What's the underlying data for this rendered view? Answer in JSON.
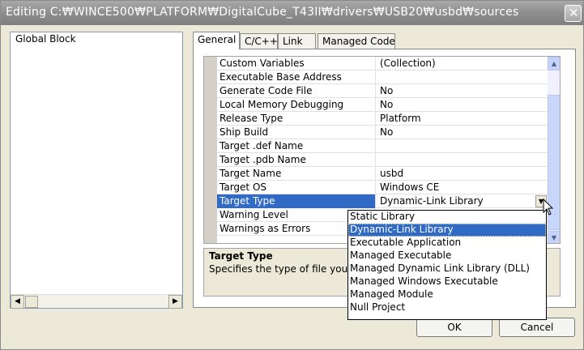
{
  "window": {
    "title": "Editing C:₩WINCE500₩PLATFORM₩DigitalCube_T43II₩drivers₩USB20₩usbd₩sources"
  },
  "left_tree": {
    "items": [
      "Global Block"
    ]
  },
  "tabs": [
    "General",
    "C/C++",
    "Link",
    "Managed Code"
  ],
  "properties": [
    {
      "name": "Custom Variables",
      "value": "(Collection)"
    },
    {
      "name": "Executable Base Address",
      "value": ""
    },
    {
      "name": "Generate Code File",
      "value": "No"
    },
    {
      "name": "Local Memory Debugging",
      "value": "No"
    },
    {
      "name": "Release Type",
      "value": "Platform"
    },
    {
      "name": "Ship Build",
      "value": "No"
    },
    {
      "name": "Target .def Name",
      "value": ""
    },
    {
      "name": "Target .pdb Name",
      "value": ""
    },
    {
      "name": "Target Name",
      "value": "usbd"
    },
    {
      "name": "Target OS",
      "value": "Windows CE"
    },
    {
      "name": "Target Type",
      "value": "Dynamic-Link Library"
    },
    {
      "name": "Warning Level",
      "value": ""
    },
    {
      "name": "Warnings as Errors",
      "value": ""
    }
  ],
  "selected_property": "Target Type",
  "description": {
    "title": "Target Type",
    "text": "Specifies the type of file you w"
  },
  "dropdown": {
    "options": [
      "Static Library",
      "Dynamic-Link Library",
      "Executable Application",
      "Managed Executable",
      "Managed Dynamic Link Library (DLL)",
      "Managed Windows Executable",
      "Managed Module",
      "Null Project"
    ],
    "selected": "Dynamic-Link Library"
  },
  "buttons": {
    "ok": "OK",
    "cancel": "Cancel"
  },
  "icons": {
    "close": "close-icon",
    "scroll_left": "arrow-left-icon",
    "scroll_right": "arrow-right-icon",
    "scroll_up": "arrow-up-icon",
    "scroll_down": "arrow-down-icon",
    "dropdown": "chevron-down-icon",
    "cursor": "mouse-pointer-icon"
  },
  "colors": {
    "selection": "#316ac5",
    "dialog_bg": "#ece9d8",
    "titlebar": "#8e8e8e"
  }
}
